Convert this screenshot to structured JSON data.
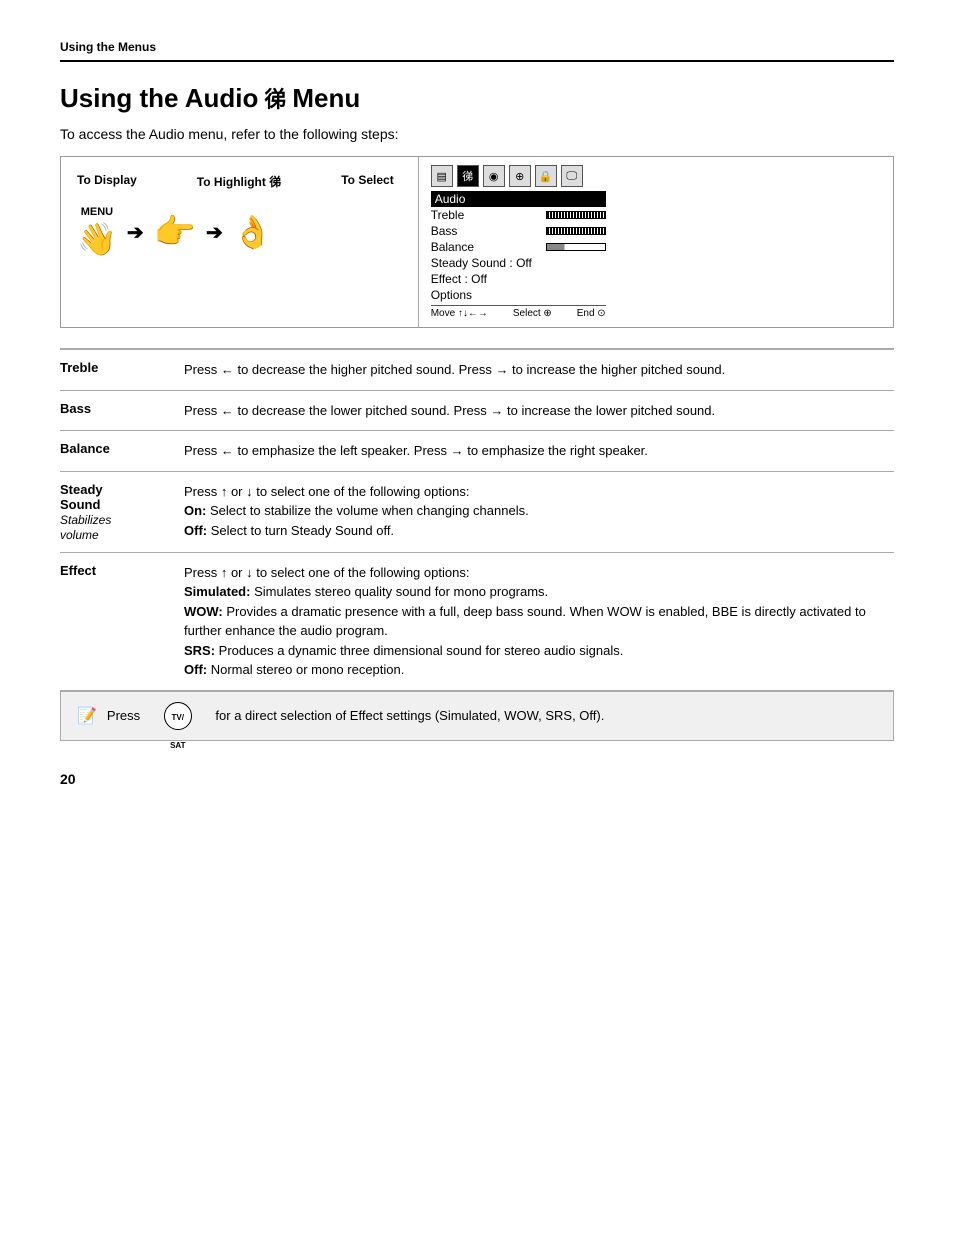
{
  "breadcrumb": "Using the Menus",
  "page_title": "Using the Audio",
  "audio_symbol": "㣢",
  "page_title_suffix": "Menu",
  "intro": "To access the Audio menu, refer to the following steps:",
  "diagram": {
    "col1_label": "To Display",
    "col2_label": "To Highlight 㣢",
    "col3_label": "To Select",
    "menu_label": "MENU",
    "arrow1": "➔",
    "arrow2": "➔",
    "menu_items": [
      {
        "name": "Audio",
        "bar": "none",
        "selected": true
      },
      {
        "name": "Treble",
        "bar": "full"
      },
      {
        "name": "Bass",
        "bar": "full"
      },
      {
        "name": "Balance",
        "bar": "half"
      },
      {
        "name": "Steady Sound : Off",
        "bar": "none"
      },
      {
        "name": "Effect : Off",
        "bar": "none"
      },
      {
        "name": "Options",
        "bar": "none"
      }
    ],
    "footer_move": "Move ↑↓←→",
    "footer_select": "Select ⊕",
    "footer_end": "End ⊙"
  },
  "table": {
    "rows": [
      {
        "term": "Treble",
        "term_sub": "",
        "description": "Press ← to decrease the higher pitched sound. Press → to increase the higher pitched sound."
      },
      {
        "term": "Bass",
        "term_sub": "",
        "description": "Press ← to decrease the lower pitched sound. Press → to increase the lower pitched sound."
      },
      {
        "term": "Balance",
        "term_sub": "",
        "description": "Press ← to emphasize the left speaker. Press → to emphasize the right speaker."
      },
      {
        "term": "Steady Sound",
        "term_sub": "Stabilizes volume",
        "description": "Press ↑ or ↓ to select one of the following options:\nOn: Select to stabilize the volume when changing channels.\nOff: Select to turn Steady Sound off."
      },
      {
        "term": "Effect",
        "term_sub": "",
        "description": "Press ↑ or ↓ to select one of the following options:\nSimulated: Simulates stereo quality sound for mono programs.\nWOW: Provides a dramatic presence with a full, deep bass sound. When WOW is enabled, BBE is directly activated to further enhance the audio program.\nSRS: Produces a dynamic three dimensional sound for stereo audio signals.\nOff: Normal stereo or mono reception."
      }
    ]
  },
  "note": {
    "prefix": "Press",
    "suffix": "for a direct selection of Effect settings (Simulated, WOW, SRS, Off).",
    "button_label": "TV/SAT"
  },
  "page_number": "20"
}
